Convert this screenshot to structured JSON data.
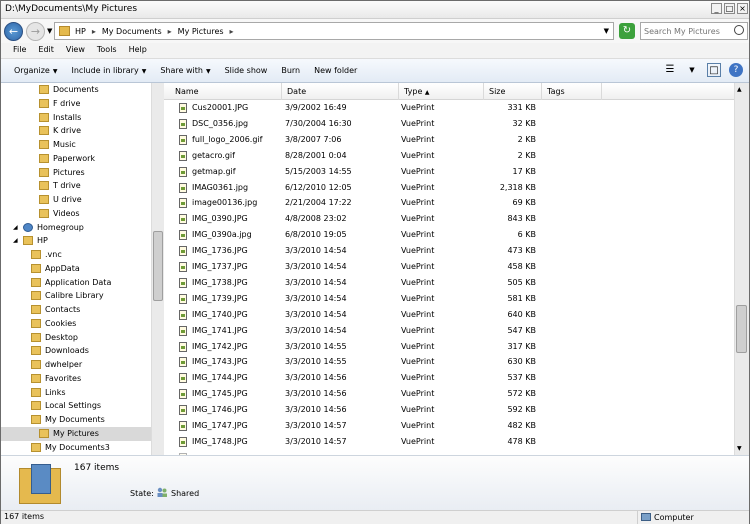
{
  "window": {
    "title": "D:\\MyDocuments\\My Pictures"
  },
  "address": {
    "crumbs": [
      "HP",
      "My Documents",
      "My Pictures"
    ]
  },
  "search": {
    "placeholder": "Search My Pictures"
  },
  "menu": [
    "File",
    "Edit",
    "View",
    "Tools",
    "Help"
  ],
  "toolbar": {
    "organize": "Organize",
    "include": "Include in library",
    "share": "Share with",
    "slideshow": "Slide show",
    "burn": "Burn",
    "newfolder": "New folder"
  },
  "nav": [
    {
      "label": "Documents",
      "level": 3
    },
    {
      "label": "F drive",
      "level": 3
    },
    {
      "label": "Installs",
      "level": 3
    },
    {
      "label": "K drive",
      "level": 3
    },
    {
      "label": "Music",
      "level": 3
    },
    {
      "label": "Paperwork",
      "level": 3
    },
    {
      "label": "Pictures",
      "level": 3
    },
    {
      "label": "T drive",
      "level": 3
    },
    {
      "label": "U drive",
      "level": 3
    },
    {
      "label": "Videos",
      "level": 3
    },
    {
      "label": "Homegroup",
      "level": 1
    },
    {
      "label": "HP",
      "level": 1
    },
    {
      "label": ".vnc",
      "level": 2
    },
    {
      "label": "AppData",
      "level": 2
    },
    {
      "label": "Application Data",
      "level": 2
    },
    {
      "label": "Calibre Library",
      "level": 2
    },
    {
      "label": "Contacts",
      "level": 2
    },
    {
      "label": "Cookies",
      "level": 2
    },
    {
      "label": "Desktop",
      "level": 2
    },
    {
      "label": "Downloads",
      "level": 2
    },
    {
      "label": "dwhelper",
      "level": 2
    },
    {
      "label": "Favorites",
      "level": 2
    },
    {
      "label": "Links",
      "level": 2
    },
    {
      "label": "Local Settings",
      "level": 2
    },
    {
      "label": "My Documents",
      "level": 2
    },
    {
      "label": "My Pictures",
      "level": 3,
      "selected": true
    },
    {
      "label": "My Documents3",
      "level": 2
    }
  ],
  "columns": {
    "name": "Name",
    "date": "Date",
    "type": "Type",
    "size": "Size",
    "tags": "Tags"
  },
  "files": [
    {
      "name": "Cus20001.JPG",
      "date": "3/9/2002 16:49",
      "type": "VuePrint",
      "size": "331 KB"
    },
    {
      "name": "DSC_0356.jpg",
      "date": "7/30/2004 16:30",
      "type": "VuePrint",
      "size": "32 KB"
    },
    {
      "name": "full_logo_2006.gif",
      "date": "3/8/2007 7:06",
      "type": "VuePrint",
      "size": "2 KB"
    },
    {
      "name": "getacro.gif",
      "date": "8/28/2001 0:04",
      "type": "VuePrint",
      "size": "2 KB"
    },
    {
      "name": "getmap.gif",
      "date": "5/15/2003 14:55",
      "type": "VuePrint",
      "size": "17 KB"
    },
    {
      "name": "IMAG0361.jpg",
      "date": "6/12/2010 12:05",
      "type": "VuePrint",
      "size": "2,318 KB"
    },
    {
      "name": "image00136.jpg",
      "date": "2/21/2004 17:22",
      "type": "VuePrint",
      "size": "69 KB"
    },
    {
      "name": "IMG_0390.JPG",
      "date": "4/8/2008 23:02",
      "type": "VuePrint",
      "size": "843 KB"
    },
    {
      "name": "IMG_0390a.jpg",
      "date": "6/8/2010 19:05",
      "type": "VuePrint",
      "size": "6 KB"
    },
    {
      "name": "IMG_1736.JPG",
      "date": "3/3/2010 14:54",
      "type": "VuePrint",
      "size": "473 KB"
    },
    {
      "name": "IMG_1737.JPG",
      "date": "3/3/2010 14:54",
      "type": "VuePrint",
      "size": "458 KB"
    },
    {
      "name": "IMG_1738.JPG",
      "date": "3/3/2010 14:54",
      "type": "VuePrint",
      "size": "505 KB"
    },
    {
      "name": "IMG_1739.JPG",
      "date": "3/3/2010 14:54",
      "type": "VuePrint",
      "size": "581 KB"
    },
    {
      "name": "IMG_1740.JPG",
      "date": "3/3/2010 14:54",
      "type": "VuePrint",
      "size": "640 KB"
    },
    {
      "name": "IMG_1741.JPG",
      "date": "3/3/2010 14:54",
      "type": "VuePrint",
      "size": "547 KB"
    },
    {
      "name": "IMG_1742.JPG",
      "date": "3/3/2010 14:55",
      "type": "VuePrint",
      "size": "317 KB"
    },
    {
      "name": "IMG_1743.JPG",
      "date": "3/3/2010 14:55",
      "type": "VuePrint",
      "size": "630 KB"
    },
    {
      "name": "IMG_1744.JPG",
      "date": "3/3/2010 14:56",
      "type": "VuePrint",
      "size": "537 KB"
    },
    {
      "name": "IMG_1745.JPG",
      "date": "3/3/2010 14:56",
      "type": "VuePrint",
      "size": "572 KB"
    },
    {
      "name": "IMG_1746.JPG",
      "date": "3/3/2010 14:56",
      "type": "VuePrint",
      "size": "592 KB"
    },
    {
      "name": "IMG_1747.JPG",
      "date": "3/3/2010 14:57",
      "type": "VuePrint",
      "size": "482 KB"
    },
    {
      "name": "IMG_1748.JPG",
      "date": "3/3/2010 14:57",
      "type": "VuePrint",
      "size": "478 KB"
    }
  ],
  "details": {
    "count": "167 items",
    "state_label": "State:",
    "state_value": "Shared"
  },
  "status": {
    "items": "167 items",
    "location": "Computer"
  }
}
